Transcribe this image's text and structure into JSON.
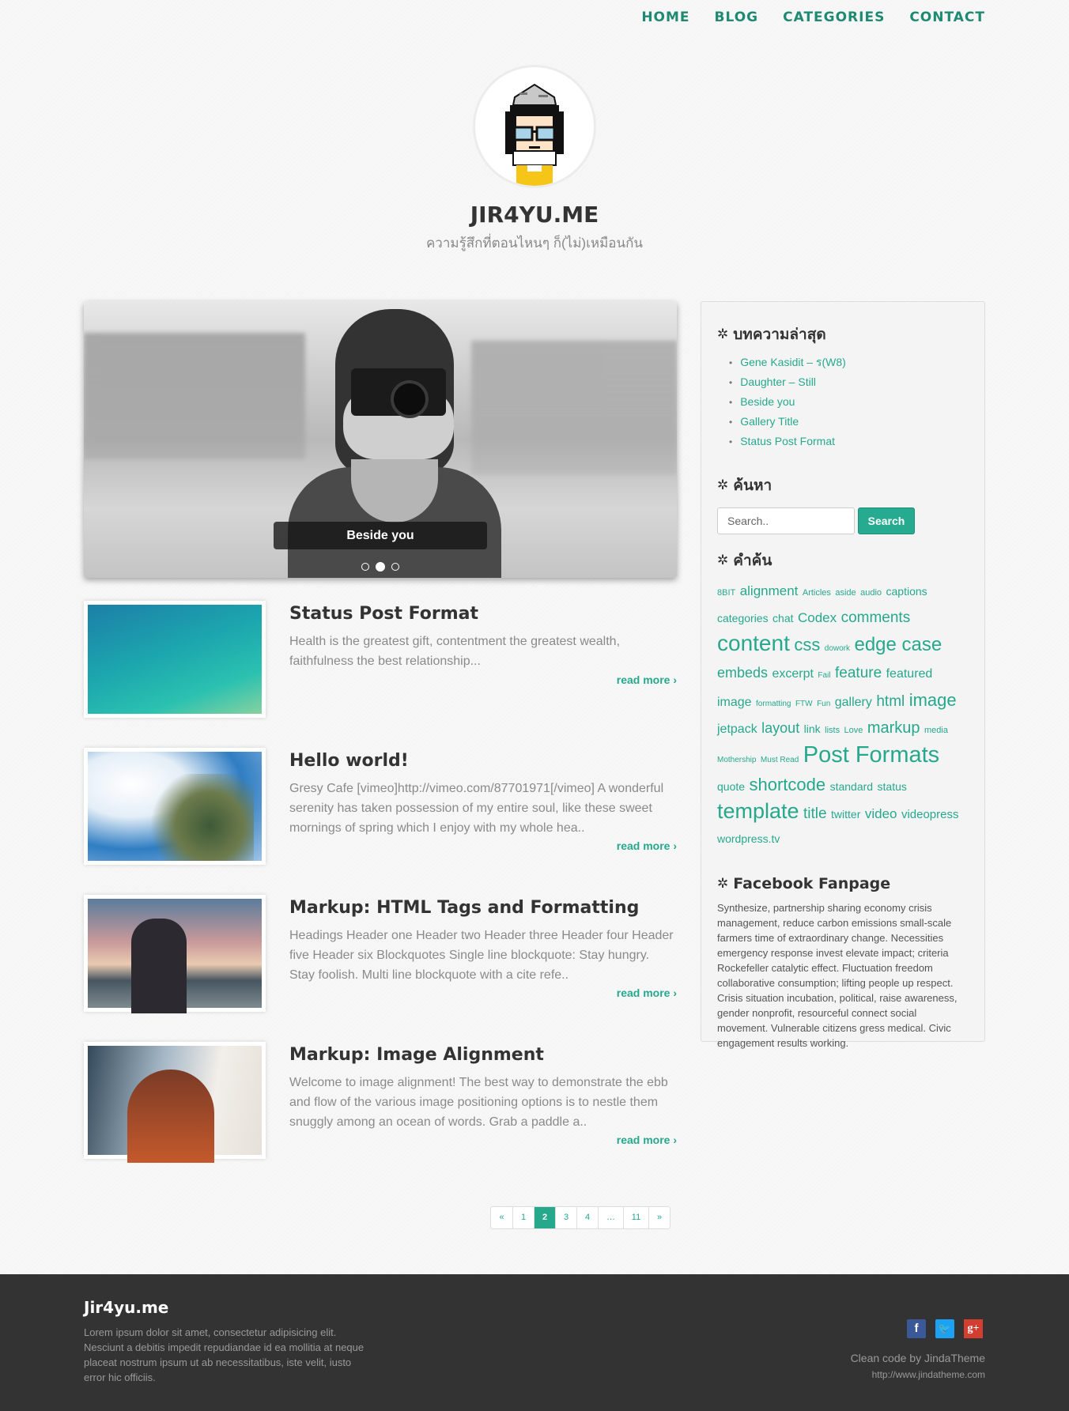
{
  "nav": {
    "items": [
      {
        "label": "HOME"
      },
      {
        "label": "BLOG"
      },
      {
        "label": "CATEGORIES"
      },
      {
        "label": "CONTACT"
      }
    ]
  },
  "header": {
    "avatar_icon": "pixel-art-avatar",
    "title": "JIR4YU.ME",
    "tagline": "ความรู้สึกที่ตอนไหนๆ ก็(ไม่)เหมือนกัน"
  },
  "slider": {
    "caption": "Beside you",
    "slide_count": 3,
    "active_index": 1
  },
  "posts": [
    {
      "title": "Status Post Format",
      "excerpt": "Health is the greatest gift, contentment the greatest wealth, faithfulness the best relationship...",
      "read_more": "read more ›"
    },
    {
      "title": "Hello world!",
      "excerpt": "Gresy Cafe [vimeo]http://vimeo.com/87701971[/vimeo] A wonderful serenity has taken possession of my entire soul, like these sweet mornings of spring which I enjoy with my whole hea..",
      "read_more": "read more ›"
    },
    {
      "title": "Markup: HTML Tags and Formatting",
      "excerpt": "Headings Header one Header two Header three Header four Header five Header six Blockquotes Single line blockquote: Stay hungry. Stay foolish. Multi line blockquote with a cite refe..",
      "read_more": "read more ›"
    },
    {
      "title": "Markup: Image Alignment",
      "excerpt": "Welcome to image alignment! The best way to demonstrate the ebb and flow of the various image positioning options is to nestle them snuggly among an ocean of words. Grab a paddle a..",
      "read_more": "read more ›"
    }
  ],
  "pagination": {
    "prev": "«",
    "pages": [
      "1",
      "2",
      "3",
      "4",
      "…",
      "11"
    ],
    "active": "2",
    "next": "»"
  },
  "sidebar": {
    "recent": {
      "title": "บทความล่าสุด",
      "items": [
        "Gene Kasidit – ร(W8)",
        "Daughter – Still",
        "Beside you",
        "Gallery Title",
        "Status Post Format"
      ]
    },
    "search": {
      "title": "ค้นหา",
      "placeholder": "Search..",
      "button": "Search"
    },
    "tags": {
      "title": "คำค้น",
      "items": [
        {
          "label": "8BIT",
          "size": 11
        },
        {
          "label": "alignment",
          "size": 17
        },
        {
          "label": "Articles",
          "size": 11
        },
        {
          "label": "aside",
          "size": 11
        },
        {
          "label": "audio",
          "size": 11
        },
        {
          "label": "captions",
          "size": 14
        },
        {
          "label": "categories",
          "size": 14
        },
        {
          "label": "chat",
          "size": 14
        },
        {
          "label": "Codex",
          "size": 17
        },
        {
          "label": "comments",
          "size": 19
        },
        {
          "label": "content",
          "size": 28
        },
        {
          "label": "css",
          "size": 22
        },
        {
          "label": "dowork",
          "size": 10
        },
        {
          "label": "edge case",
          "size": 24
        },
        {
          "label": "embeds",
          "size": 18
        },
        {
          "label": "excerpt",
          "size": 16
        },
        {
          "label": "Fail",
          "size": 10
        },
        {
          "label": "feature",
          "size": 19
        },
        {
          "label": "featured",
          "size": 16
        },
        {
          "label": "image",
          "size": 16
        },
        {
          "label": "formatting",
          "size": 10
        },
        {
          "label": "FTW",
          "size": 10
        },
        {
          "label": "Fun",
          "size": 10
        },
        {
          "label": "gallery",
          "size": 16
        },
        {
          "label": "html",
          "size": 19
        },
        {
          "label": "image",
          "size": 22
        },
        {
          "label": "jetpack",
          "size": 16
        },
        {
          "label": "layout",
          "size": 18
        },
        {
          "label": "link",
          "size": 14
        },
        {
          "label": "lists",
          "size": 11
        },
        {
          "label": "Love",
          "size": 11
        },
        {
          "label": "markup",
          "size": 20
        },
        {
          "label": "media",
          "size": 11
        },
        {
          "label": "Mothership",
          "size": 10
        },
        {
          "label": "Must Read",
          "size": 10
        },
        {
          "label": "Post Formats",
          "size": 29
        },
        {
          "label": "quote",
          "size": 14
        },
        {
          "label": "shortcode",
          "size": 22
        },
        {
          "label": "standard",
          "size": 14
        },
        {
          "label": "status",
          "size": 14
        },
        {
          "label": "template",
          "size": 27
        },
        {
          "label": "title",
          "size": 19
        },
        {
          "label": "twitter",
          "size": 14
        },
        {
          "label": "video",
          "size": 17
        },
        {
          "label": "videopress",
          "size": 15
        },
        {
          "label": "wordpress.tv",
          "size": 14
        }
      ]
    },
    "facebook": {
      "title": "Facebook Fanpage",
      "text": "Synthesize, partnership sharing economy crisis management, reduce carbon emissions small-scale farmers time of extraordinary change. Necessities emergency response invest elevate impact; criteria Rockefeller catalytic effect. Fluctuation freedom collaborative consumption; lifting people up respect. Crisis situation incubation, political, raise awareness, gender nonprofit, resourceful connect social movement. Vulnerable citizens gress medical. Civic engagement results working."
    }
  },
  "footer": {
    "title": "Jir4yu.me",
    "text": "Lorem ipsum dolor sit amet, consectetur adipisicing elit. Nesciunt a debitis impedit repudiandae id ea mollitia at neque placeat nostrum ipsum ut ab necessitatibus, iste velit, iusto error hic officiis.",
    "social": [
      {
        "name": "facebook",
        "glyph": "f"
      },
      {
        "name": "twitter",
        "glyph": "t"
      },
      {
        "name": "google-plus",
        "glyph": "g+"
      }
    ],
    "credit": "Clean code by JindaTheme",
    "credit_url": "http://www.jindatheme.com"
  },
  "colors": {
    "accent": "#26a88d",
    "nav": "#1e8a72",
    "footer_bg": "#333333",
    "sidebar_bg": "#f4f4f4"
  }
}
